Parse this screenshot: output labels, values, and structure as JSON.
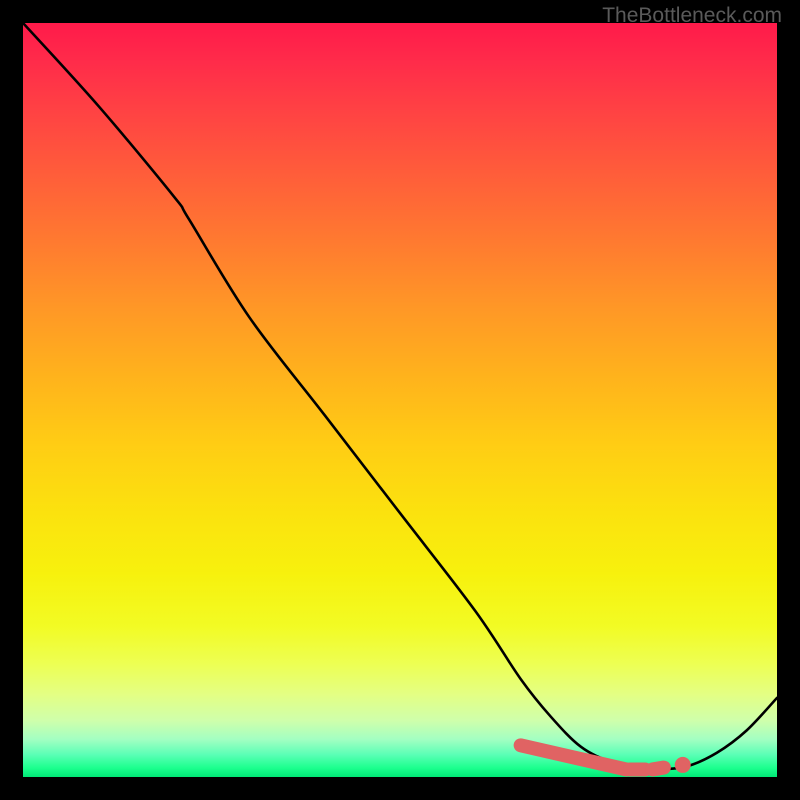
{
  "watermark": "TheBottleneck.com",
  "chart_data": {
    "type": "line",
    "title": "",
    "xlabel": "",
    "ylabel": "",
    "xlim": [
      0,
      100
    ],
    "ylim": [
      0,
      100
    ],
    "series": [
      {
        "name": "curve",
        "x": [
          0,
          10,
          20,
          22,
          30,
          40,
          50,
          60,
          66,
          70,
          74,
          78,
          82,
          84,
          88,
          92,
          96,
          100
        ],
        "y": [
          100,
          89,
          77,
          74,
          61,
          48,
          35,
          22,
          13,
          8,
          4,
          2,
          1,
          1,
          1.4,
          3.2,
          6.2,
          10.5
        ]
      }
    ],
    "highlight_segments": [
      {
        "name": "trough-bar",
        "x0": 66,
        "y0": 4.2,
        "x1": 80,
        "y1": 1.0
      },
      {
        "name": "dash-1",
        "x0": 80.5,
        "y0": 1.0,
        "x1": 82.5,
        "y1": 1.0
      },
      {
        "name": "dash-2",
        "x0": 83.5,
        "y0": 1.0,
        "x1": 85,
        "y1": 1.25
      }
    ],
    "highlight_dot": {
      "x": 87.5,
      "y": 1.6
    },
    "colors": {
      "curve": "#000000",
      "highlight": "#e06363"
    }
  }
}
